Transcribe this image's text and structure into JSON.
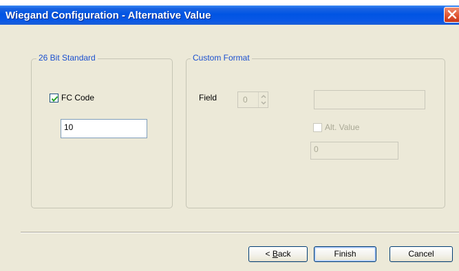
{
  "window": {
    "title": "Wiegand Configuration - Alternative Value"
  },
  "standard_group": {
    "label": "26 Bit Standard",
    "fc_code_label": "FC Code",
    "fc_code_checked": true,
    "fc_code_value": "10"
  },
  "custom_group": {
    "label": "Custom Format",
    "field_label": "Field",
    "field_value": "0",
    "field_text_value": "",
    "alt_value_label": "Alt. Value",
    "alt_value_checked": false,
    "alt_value_input": "0"
  },
  "buttons": {
    "back_prefix": "< ",
    "back_mnemonic": "B",
    "back_rest": "ack",
    "finish": "Finish",
    "cancel": "Cancel"
  },
  "colors": {
    "titlebar": "#0054e3",
    "dialog_bg": "#ece9d8",
    "group_label": "#1a4fcf",
    "disabled_text": "#a9a895"
  },
  "icons": {
    "close": "close-icon",
    "check": "checkmark-icon",
    "spin_up": "chevron-up-icon",
    "spin_down": "chevron-down-icon"
  }
}
